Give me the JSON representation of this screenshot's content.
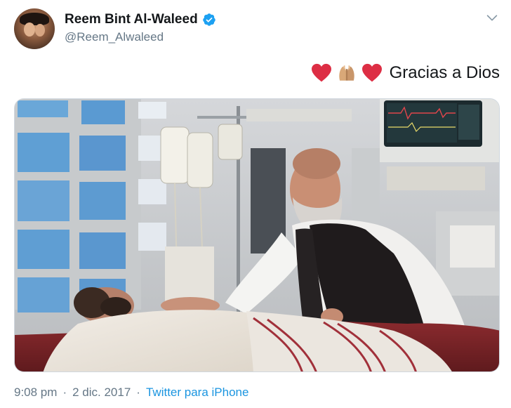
{
  "tweet": {
    "author": {
      "display_name": "Reem Bint Al-Waleed",
      "handle": "@Reem_Alwaleed",
      "verified": true
    },
    "text": "Gracias a Dios",
    "emojis": [
      "red-heart",
      "folded-hands",
      "red-heart"
    ],
    "timestamp": {
      "time": "9:08 pm",
      "separator": "·",
      "date": "2 dic. 2017"
    },
    "source": "Twitter para iPhone",
    "media_type": "photo"
  },
  "colors": {
    "text_primary": "#14171a",
    "text_secondary": "#657786",
    "link": "#1b95e0",
    "verified_badge": "#1da1f2",
    "heart": "#dd2e44"
  },
  "icons": {
    "menu": "chevron-down-icon",
    "verified": "verified-badge-icon"
  }
}
